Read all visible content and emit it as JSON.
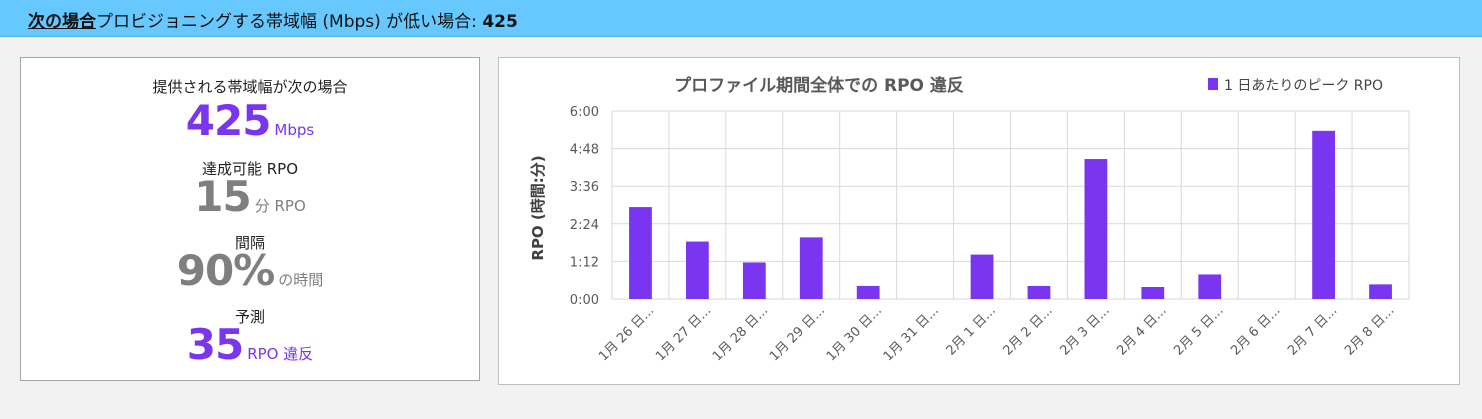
{
  "header": {
    "prefix": "次の場合",
    "text": "プロビジョニングする帯域幅 (Mbps) が低い場合:",
    "value": "425"
  },
  "summary": {
    "bandwidth_label": "提供される帯域幅が次の場合",
    "bandwidth_value": "425",
    "bandwidth_unit": "Mbps",
    "rpo_label": "達成可能 RPO",
    "rpo_value": "15",
    "rpo_unit": "分 RPO",
    "interval_label": "間隔",
    "interval_value": "90%",
    "interval_unit": "の時間",
    "forecast_label": "予測",
    "forecast_value": "35",
    "forecast_unit": "RPO 違反"
  },
  "colors": {
    "accent": "#7a35f0",
    "header_bg": "#66c8ff",
    "muted": "#7f7f7f"
  },
  "chart_data": {
    "type": "bar",
    "title": "プロファイル期間全体での RPO 違反",
    "ylabel": "RPO (時間:分)",
    "xlabel": "",
    "legend": "1 日あたりのピーク RPO",
    "legend_position": "top-right",
    "grid": true,
    "ylim": [
      0,
      360
    ],
    "yticks": [
      0,
      72,
      144,
      216,
      288,
      360
    ],
    "ytick_labels": [
      "0:00",
      "1:12",
      "2:24",
      "3:36",
      "4:48",
      "6:00"
    ],
    "categories": [
      "1月 26 日...",
      "1月 27 日...",
      "1月 28 日...",
      "1月 29 日...",
      "1月 30 日...",
      "1月 31 日...",
      "2月 1 日...",
      "2月 2 日...",
      "2月 3 日...",
      "2月 4 日...",
      "2月 5 日...",
      "2月 6 日...",
      "2月 7 日...",
      "2月 8 日..."
    ],
    "values": [
      176,
      110,
      70,
      118,
      25,
      0,
      85,
      25,
      268,
      23,
      47,
      0,
      322,
      28
    ],
    "color": "#7a35f0"
  }
}
